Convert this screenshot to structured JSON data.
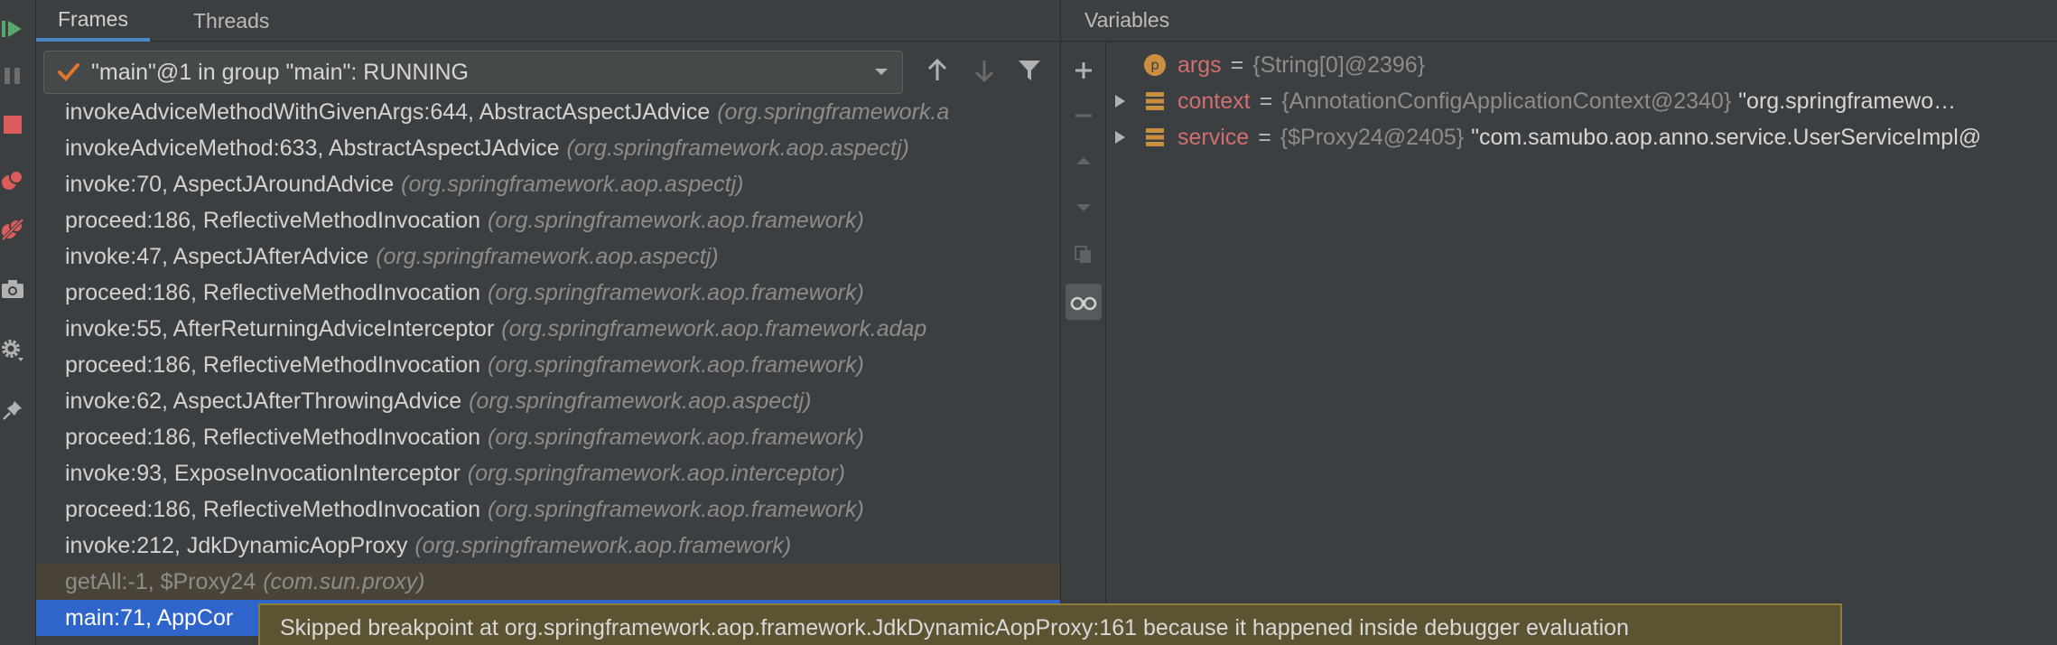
{
  "tabs": {
    "frames": "Frames",
    "threads": "Threads"
  },
  "thread_selector": {
    "value": "\"main\"@1 in group \"main\": RUNNING"
  },
  "frames": [
    {
      "name": "invokeAdviceMethodWithGivenArgs:644, AbstractAspectJAdvice",
      "pkg": "(org.springframework.a"
    },
    {
      "name": "invokeAdviceMethod:633, AbstractAspectJAdvice",
      "pkg": "(org.springframework.aop.aspectj)"
    },
    {
      "name": "invoke:70, AspectJAroundAdvice",
      "pkg": "(org.springframework.aop.aspectj)"
    },
    {
      "name": "proceed:186, ReflectiveMethodInvocation",
      "pkg": "(org.springframework.aop.framework)"
    },
    {
      "name": "invoke:47, AspectJAfterAdvice",
      "pkg": "(org.springframework.aop.aspectj)"
    },
    {
      "name": "proceed:186, ReflectiveMethodInvocation",
      "pkg": "(org.springframework.aop.framework)"
    },
    {
      "name": "invoke:55, AfterReturningAdviceInterceptor",
      "pkg": "(org.springframework.aop.framework.adap"
    },
    {
      "name": "proceed:186, ReflectiveMethodInvocation",
      "pkg": "(org.springframework.aop.framework)"
    },
    {
      "name": "invoke:62, AspectJAfterThrowingAdvice",
      "pkg": "(org.springframework.aop.aspectj)"
    },
    {
      "name": "proceed:186, ReflectiveMethodInvocation",
      "pkg": "(org.springframework.aop.framework)"
    },
    {
      "name": "invoke:93, ExposeInvocationInterceptor",
      "pkg": "(org.springframework.aop.interceptor)"
    },
    {
      "name": "proceed:186, ReflectiveMethodInvocation",
      "pkg": "(org.springframework.aop.framework)"
    },
    {
      "name": "invoke:212, JdkDynamicAopProxy",
      "pkg": "(org.springframework.aop.framework)"
    },
    {
      "name": "getAll:-1, $Proxy24",
      "pkg": "(com.sun.proxy)"
    },
    {
      "name": "main:71, AppCor",
      "pkg": ""
    }
  ],
  "variables": {
    "header": "Variables",
    "items": [
      {
        "icon": "p",
        "name": "args",
        "eq": "=",
        "id": "{String[0]@2396}",
        "value": ""
      },
      {
        "icon": "field",
        "name": "context",
        "eq": "=",
        "id": "{AnnotationConfigApplicationContext@2340}",
        "value": "\"org.springframewo…"
      },
      {
        "icon": "field",
        "name": "service",
        "eq": "=",
        "id": "{$Proxy24@2405}",
        "value": "\"com.samubo.aop.anno.service.UserServiceImpl@"
      }
    ]
  },
  "tooltip": "Skipped breakpoint at org.springframework.aop.framework.JdkDynamicAopProxy:161 because it happened inside debugger evaluation"
}
